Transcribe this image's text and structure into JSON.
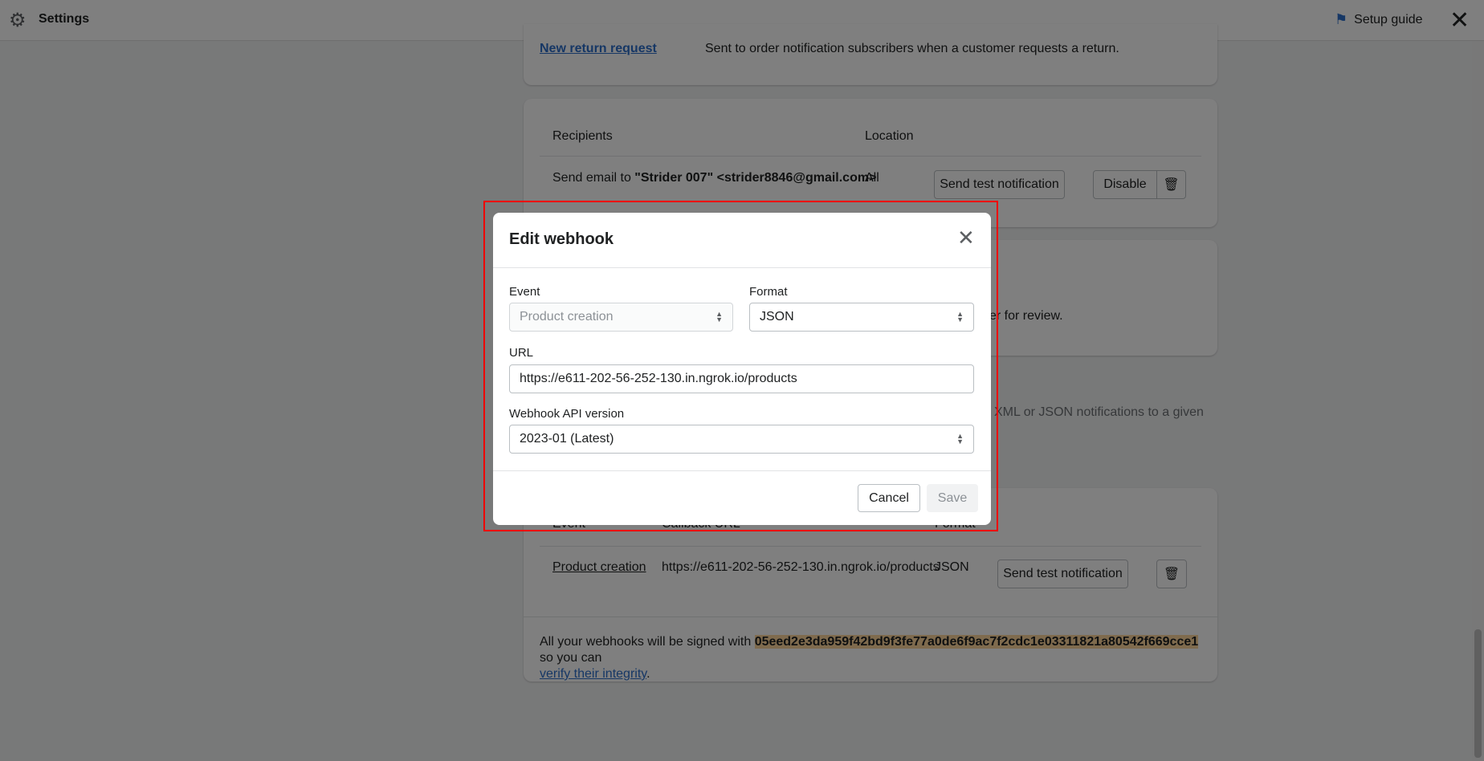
{
  "header": {
    "title": "Settings",
    "setup_guide": "Setup guide",
    "icons": [
      "gear-icon",
      "flag-icon",
      "close-icon"
    ]
  },
  "card1": {
    "link": "New return request",
    "description": "Sent to order notification subscribers when a customer requests a return."
  },
  "recipients": {
    "col_recipients": "Recipients",
    "col_location": "Location",
    "row_prefix": "Send email to ",
    "row_name": "\"Strider 007\" <strider8846@gmail.com>",
    "location": "All",
    "send_test": "Send test notification",
    "disable": "Disable"
  },
  "card3": {
    "partial_text": "er for review."
  },
  "section": {
    "partial_text": "XML or JSON notifications to a given"
  },
  "webhooks": {
    "col_event": "Event",
    "col_url": "Callback URL",
    "col_format": "Format",
    "rows": [
      {
        "event": "Product creation",
        "url": "https://e611-202-56-252-130.in.ngrok.io/products",
        "format": "JSON",
        "send_test": "Send test notification"
      }
    ],
    "footer_prefix": "All your webhooks will be signed with ",
    "signature": "05eed2e3da959f42bd9f3fe77a0de6f9ac7f2cdc1e03311821a80542f669cce1",
    "footer_suffix": " so you can",
    "verify_link": "verify their integrity",
    "footer_end": "."
  },
  "modal": {
    "title": "Edit webhook",
    "event_label": "Event",
    "event_value": "Product creation",
    "format_label": "Format",
    "format_value": "JSON",
    "url_label": "URL",
    "url_value": "https://e611-202-56-252-130.in.ngrok.io/products",
    "api_label": "Webhook API version",
    "api_value": "2023-01 (Latest)",
    "cancel": "Cancel",
    "save": "Save"
  },
  "colors": {
    "link": "#2c6ecb",
    "highlight": "#ffd79d",
    "outline": "#e00000"
  }
}
